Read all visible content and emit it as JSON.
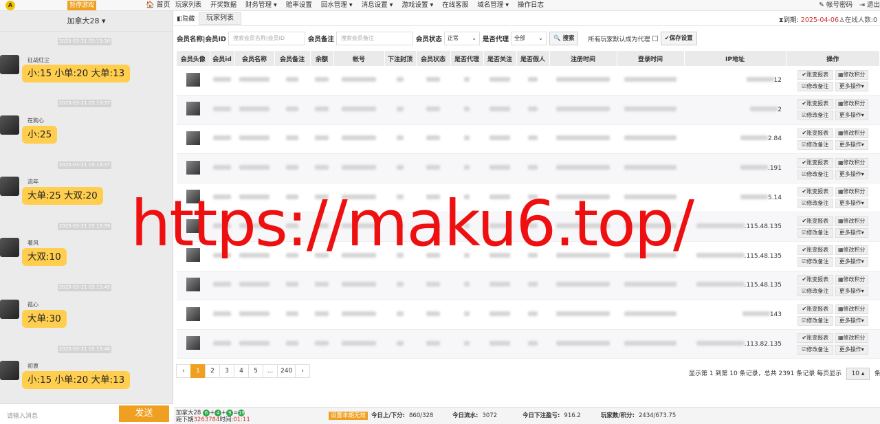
{
  "nav": {
    "logo": "A",
    "pause": "暂停游戏",
    "home": "🏠 首页",
    "menu": [
      "玩家列表",
      "开奖数据",
      "财务管理 ▾",
      "赔率设置",
      "回水管理 ▾",
      "消息设置 ▾",
      "游戏设置 ▾",
      "在线客服",
      "域名管理 ▾",
      "操作日志"
    ],
    "account": "✎ 帐号密码",
    "logout": "⇥ 退出"
  },
  "chat": {
    "group": "加拿大28 ▾",
    "messages": [
      {
        "time": "2025-03-21 03:13:30",
        "user": "征战红尘",
        "text": "小:15 小单:20 大单:13"
      },
      {
        "time": "2025-03-21 03:13:37",
        "user": "在狗心",
        "text": "小:25"
      },
      {
        "time": "2025-03-21 03:13:37",
        "user": "流年",
        "text": "大单:25 大双:20"
      },
      {
        "time": "2025-03-21 03:13:39",
        "user": "著风",
        "text": "大双:10"
      },
      {
        "time": "2025-03-21 03:13:45",
        "user": "孤心",
        "text": "大单:30"
      },
      {
        "time": "2025-03-21 03:13:46",
        "user": "初衷",
        "text": "小:15 小单:20 大单:13"
      }
    ],
    "input_placeholder": "请输入消息",
    "send": "发送"
  },
  "tabs": {
    "hide": "◧隐藏",
    "active": "玩家列表",
    "expire_label": "⧗到期:",
    "expire_date": "2025-04-06",
    "online": "♙在线人数:0"
  },
  "filters": {
    "name_label": "会员名称|会员ID",
    "name_placeholder": "搜索会员名称|会员ID",
    "note_label": "会员备注",
    "note_placeholder": "搜索会员备注",
    "status_label": "会员状态",
    "status_value": "正常",
    "agent_label": "是否代理",
    "agent_value": "全部",
    "search": "🔍 搜索",
    "default_agent": "所有玩家默认成为代理",
    "save": "✔保存设置"
  },
  "table": {
    "headers": [
      "会员头像",
      "会员id",
      "会员名称",
      "会员备注",
      "余额",
      "帐号",
      "下注封顶",
      "会员状态",
      "是否代理",
      "是否关注",
      "是否假人",
      "注册时间",
      "登录时间",
      "IP地址",
      "操作"
    ],
    "ip_suffixes": [
      "12",
      "2",
      "2.84",
      ".191",
      "5.14",
      ".115.48.135",
      ".115.48.135",
      ".115.48.135",
      "143",
      ".113.82.135"
    ],
    "ops": [
      "✔账变报表",
      "▦修改积分",
      "☑修改备注",
      "更多操作▾"
    ]
  },
  "pager": {
    "pages": [
      "‹",
      "1",
      "2",
      "3",
      "4",
      "5",
      "...",
      "240",
      "›"
    ],
    "summary": "显示第 1 到第 10 条记录，总共 2391 条记录 每页显示",
    "size": "10 ▴",
    "suffix": "条记录"
  },
  "footer": {
    "game": "加拿大28",
    "balls": [
      "6",
      "4",
      "9",
      "19"
    ],
    "next_label": "距下期",
    "next_issue": "3263784",
    "time_label": "时间:",
    "countdown": "01:11",
    "invalid": "设置本期无效",
    "today_updown_label": "今日上/下分:",
    "today_updown": "860/328",
    "today_flow_label": "今日流水:",
    "today_flow": "3072",
    "today_profit_label": "今日下注盈亏:",
    "today_profit": "916.2",
    "players_label": "玩家数/积分:",
    "players": "2434/673.75"
  },
  "watermark": "https://maku6.top/"
}
